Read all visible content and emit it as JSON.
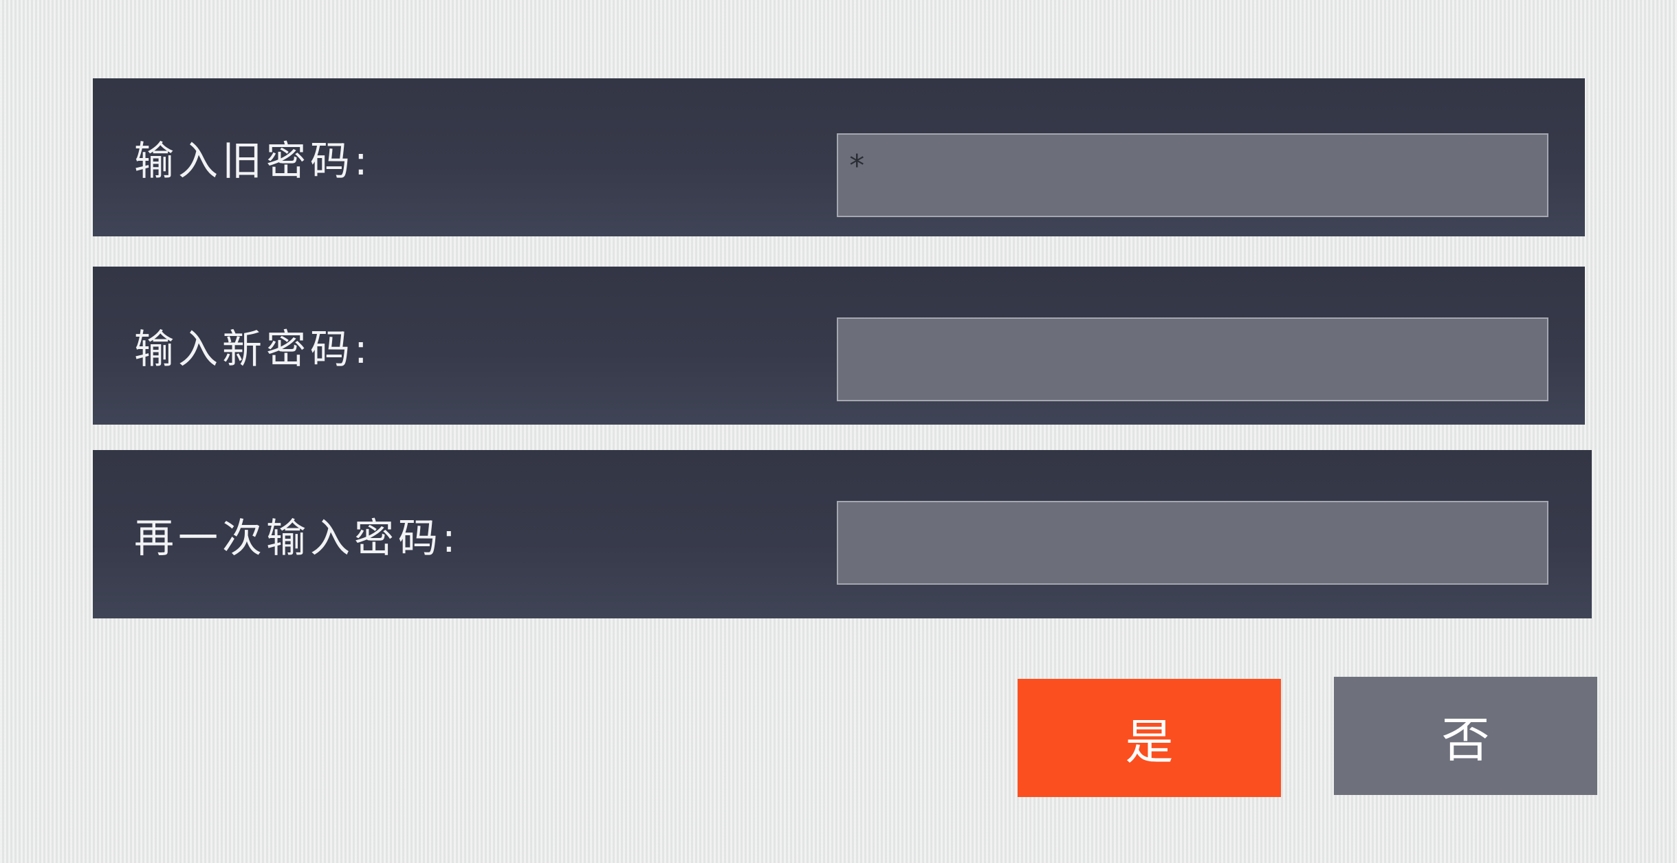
{
  "form": {
    "old_password": {
      "label": "输入旧密码:",
      "value": "*"
    },
    "new_password": {
      "label": "输入新密码:",
      "value": ""
    },
    "confirm_password": {
      "label": "再一次输入密码:",
      "value": ""
    }
  },
  "actions": {
    "yes_label": "是",
    "no_label": "否"
  },
  "colors": {
    "panel": "#373a4a",
    "field": "#6c6f7a",
    "confirm_button": "#fb4f1f",
    "cancel_button": "#6e717c",
    "background": "#e9ebea"
  }
}
